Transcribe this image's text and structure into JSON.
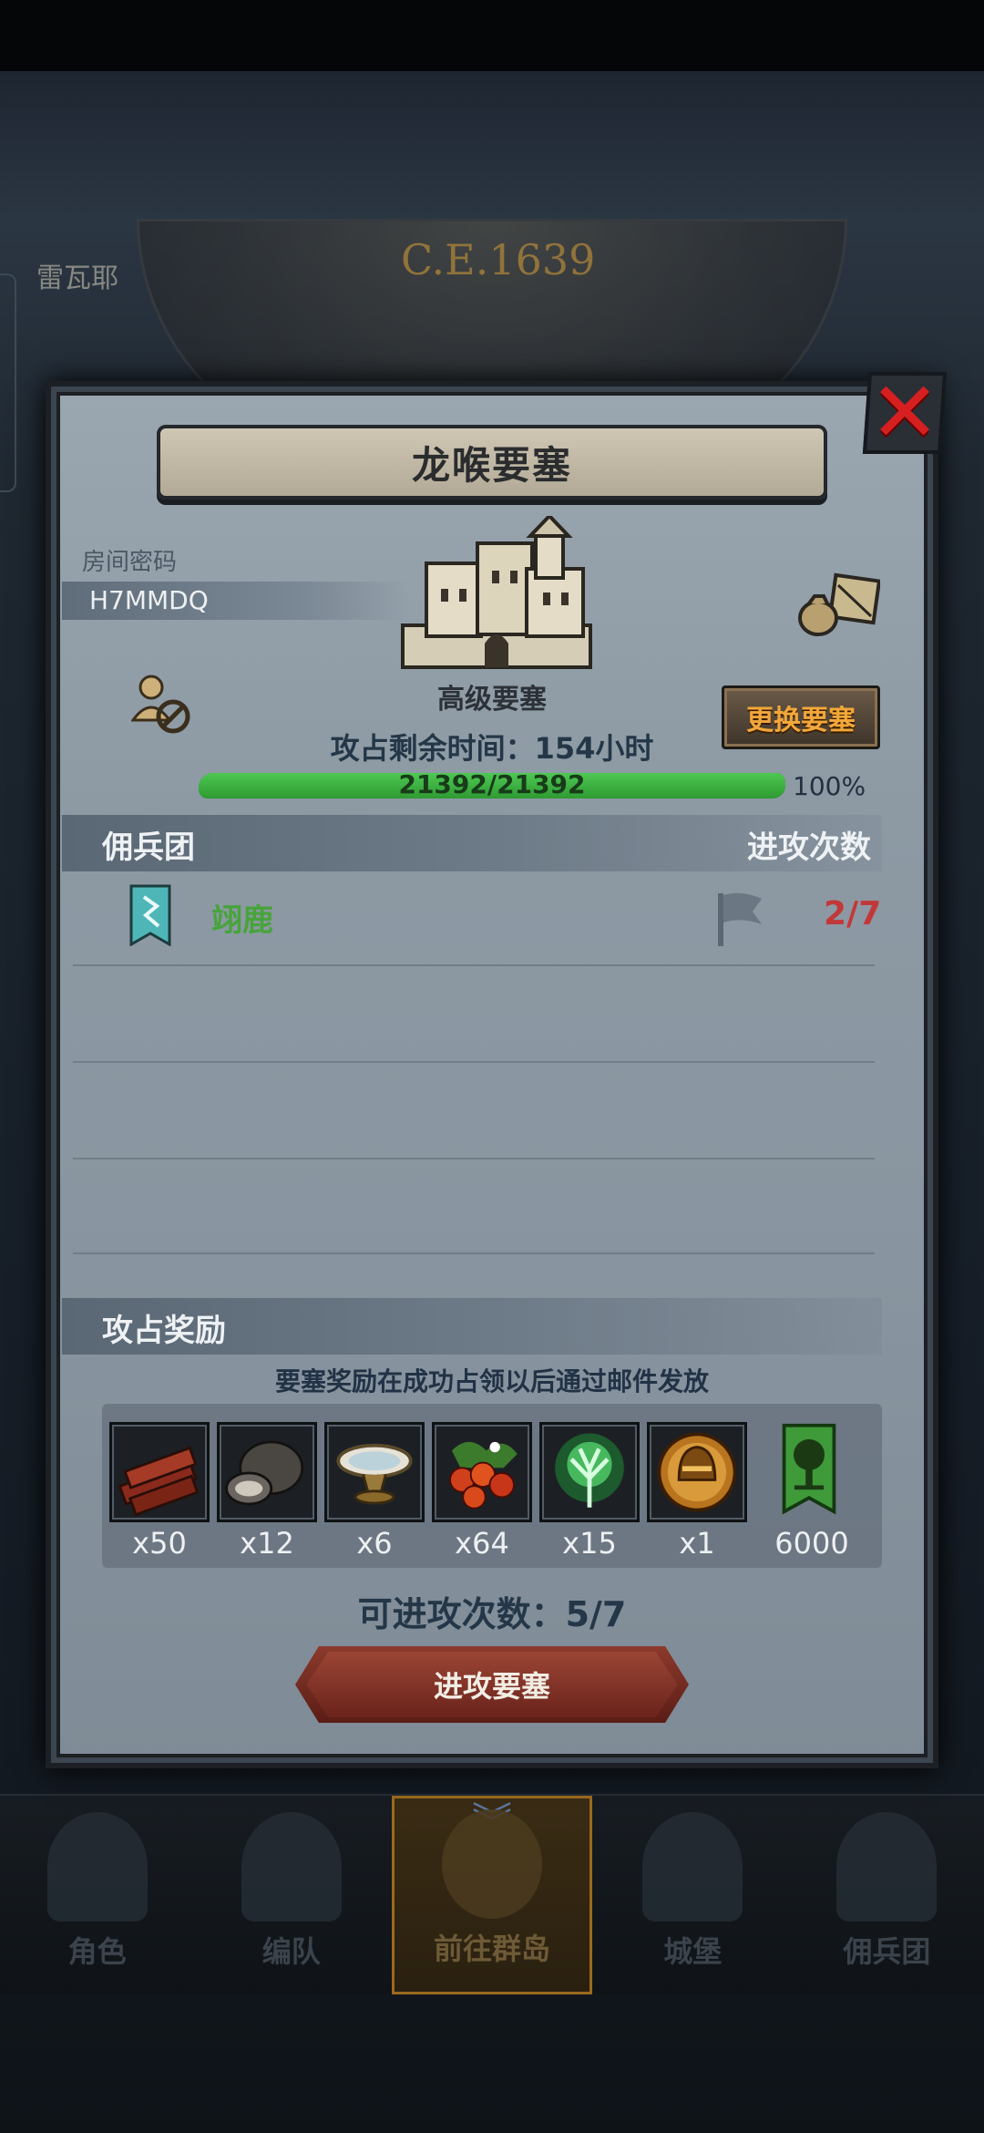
{
  "background": {
    "era": "C.E.1639",
    "left_chip": "雷瓦耶"
  },
  "modal": {
    "title": "龙喉要塞",
    "room_label": "房间密码",
    "room_code": "H7MMDQ",
    "fortress_grade": "高级要塞",
    "time_left": "攻占剩余时间：154小时",
    "swap_button": "更换要塞",
    "hp": {
      "current": 21392,
      "max": 21392,
      "text": "21392/21392",
      "percent_text": "100%"
    },
    "mercenary_header": "佣兵团",
    "attack_count_header": "进攻次数",
    "guilds": [
      {
        "name": "翊鹿",
        "attacks": "2/7",
        "emblem_color": "#4fb6b8"
      }
    ],
    "rewards_header": "攻占奖励",
    "reward_note": "要塞奖励在成功占领以后通过邮件发放",
    "rewards": [
      {
        "icon": "wood-icon",
        "qty": "x50"
      },
      {
        "icon": "ore-icon",
        "qty": "x12"
      },
      {
        "icon": "bowl-icon",
        "qty": "x6"
      },
      {
        "icon": "berries-icon",
        "qty": "x64"
      },
      {
        "icon": "spirit-tree-icon",
        "qty": "x15"
      },
      {
        "icon": "helmet-coin-icon",
        "qty": "x1"
      },
      {
        "icon": "tree-banner-icon",
        "qty": "6000"
      }
    ],
    "attacks_left": "可进攻次数：5/7",
    "attack_button": "进攻要塞"
  },
  "bottom_nav": [
    {
      "label": "角色",
      "active": false
    },
    {
      "label": "编队",
      "active": false
    },
    {
      "label": "前往群岛",
      "active": true
    },
    {
      "label": "城堡",
      "active": false
    },
    {
      "label": "佣兵团",
      "active": false
    }
  ],
  "colors": {
    "accent_gold": "#f2a73a",
    "hp_green": "#3fb444",
    "attack_red": "#c23838",
    "close_red": "#d62020"
  }
}
